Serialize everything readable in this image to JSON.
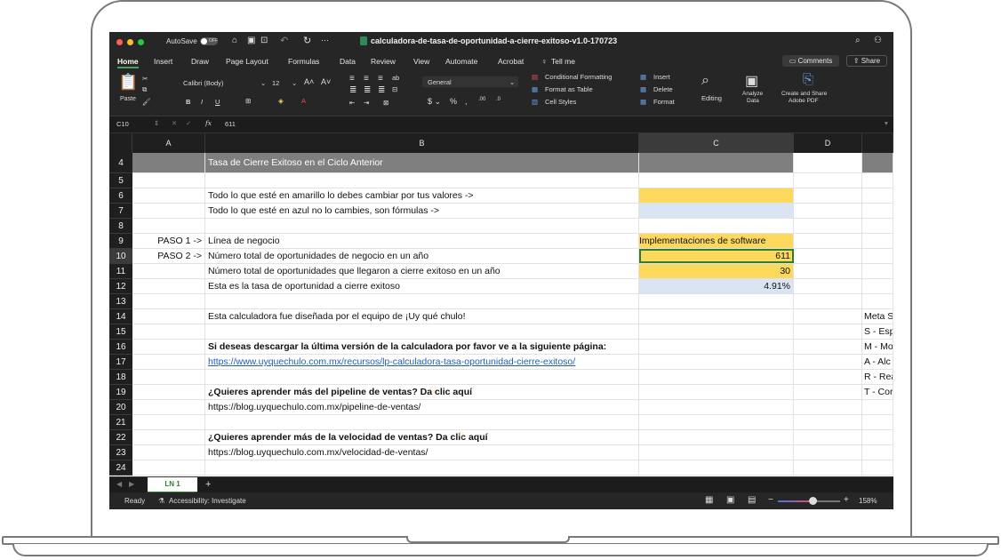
{
  "window": {
    "autosave_label": "AutoSave",
    "autosave_state": "OFF",
    "doc_title": "calculadora-de-tasa-de-oportunidad-a-cierre-exitoso-v1.0-170723"
  },
  "menu": {
    "items": [
      "Home",
      "Insert",
      "Draw",
      "Page Layout",
      "Formulas",
      "Data",
      "Review",
      "View",
      "Automate",
      "Acrobat"
    ],
    "tell_me": "Tell me",
    "comments": "Comments",
    "share": "Share"
  },
  "ribbon": {
    "paste": "Paste",
    "font_name": "Calibri (Body)",
    "font_size": "12",
    "number_format": "General",
    "conditional_formatting": "Conditional Formatting",
    "format_as_table": "Format as Table",
    "cell_styles": "Cell Styles",
    "insert": "Insert",
    "delete": "Delete",
    "format": "Format",
    "editing": "Editing",
    "analyze_data_1": "Analyze",
    "analyze_data_2": "Data",
    "create_share_1": "Create and Share",
    "create_share_2": "Adobe PDF"
  },
  "formula_bar": {
    "cell_ref": "C10",
    "fx": "fx",
    "value": "611"
  },
  "columns": [
    "A",
    "B",
    "C",
    "D"
  ],
  "rows": {
    "r4": {
      "num": "4",
      "b": "Tasa de Cierre Exitoso en el Ciclo Anterior"
    },
    "r5": {
      "num": "5"
    },
    "r6": {
      "num": "6",
      "b": "Todo lo que esté en amarillo lo debes cambiar por tus valores ->"
    },
    "r7": {
      "num": "7",
      "b": "Todo lo que esté en azul no lo cambies, son fórmulas ->"
    },
    "r8": {
      "num": "8"
    },
    "r9": {
      "num": "9",
      "a": "PASO 1 ->",
      "b": "Línea de negocio",
      "c": "Implementaciones de software"
    },
    "r10": {
      "num": "10",
      "a": "PASO 2 ->",
      "b": "Número total de oportunidades de negocio en un año",
      "c": "611"
    },
    "r11": {
      "num": "11",
      "b": "Número total de oportunidades que llegaron a cierre exitoso en un año",
      "c": "30"
    },
    "r12": {
      "num": "12",
      "b": "Esta es la tasa de oportunidad a cierre exitoso",
      "c": "4.91%"
    },
    "r13": {
      "num": "13"
    },
    "r14": {
      "num": "14",
      "b": "Esta calculadora fue diseñada por el equipo de ¡Uy qué chulo!",
      "e": "Meta S"
    },
    "r15": {
      "num": "15",
      "e": "S - Esp"
    },
    "r16": {
      "num": "16",
      "b": "Si deseas descargar la última versión de la calculadora por favor ve a la siguiente página:",
      "e": "M - Mo"
    },
    "r17": {
      "num": "17",
      "b": "https://www.uyquechulo.com.mx/recursos/lp-calculadora-tasa-oportunidad-cierre-exitoso/",
      "e": "A - Alc"
    },
    "r18": {
      "num": "18",
      "e": "R - Rea"
    },
    "r19": {
      "num": "19",
      "b": "¿Quieres aprender más del pipeline de ventas? Da clic aquí",
      "e": "T - Cor"
    },
    "r20": {
      "num": "20",
      "b": "https://blog.uyquechulo.com.mx/pipeline-de-ventas/"
    },
    "r21": {
      "num": "21"
    },
    "r22": {
      "num": "22",
      "b": "¿Quieres aprender más de la velocidad de ventas? Da clic aquí"
    },
    "r23": {
      "num": "23",
      "b": "https://blog.uyquechulo.com.mx/velocidad-de-ventas/"
    },
    "r24": {
      "num": "24"
    }
  },
  "sheet_tab": "LN 1",
  "status": {
    "ready": "Ready",
    "accessibility": "Accessibility: Investigate",
    "zoom": "158%"
  }
}
